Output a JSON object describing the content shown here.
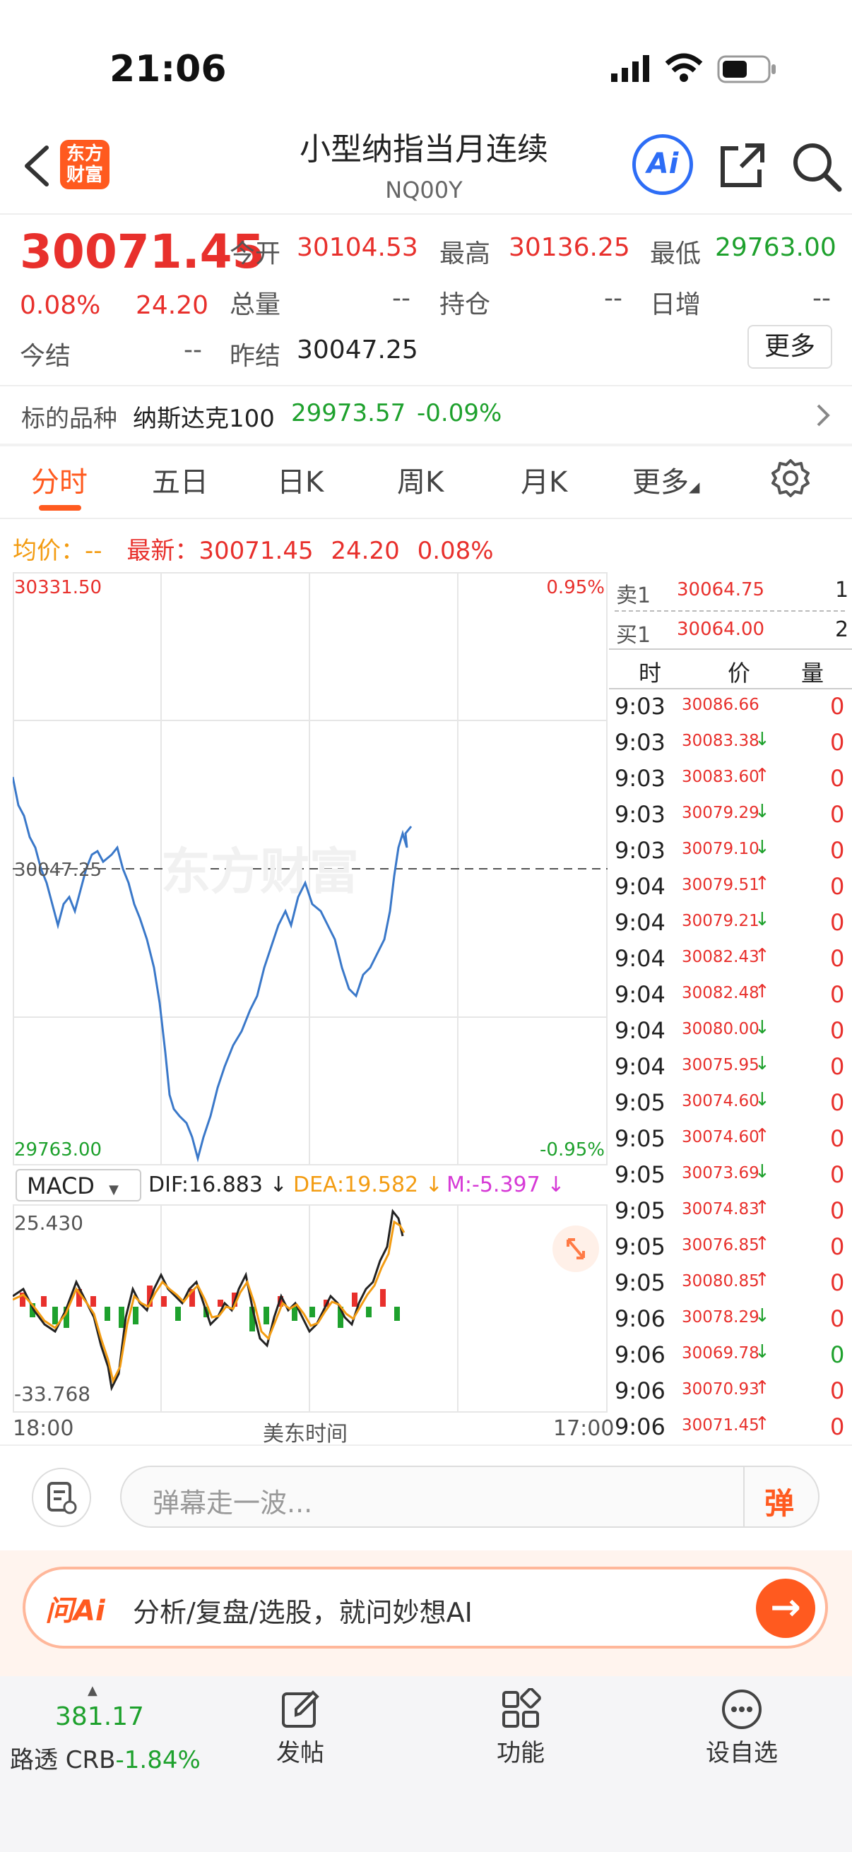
{
  "status_bar": {
    "time": "21:06"
  },
  "header": {
    "logo_text_1": "东方",
    "logo_text_2": "财富",
    "title": "小型纳指当月连续",
    "code": "NQ00Y",
    "ai_label": "Ai"
  },
  "quote": {
    "last_price": "30071.45",
    "change_pct": "0.08%",
    "change": "24.20",
    "open_label": "今开",
    "open": "30104.53",
    "high_label": "最高",
    "high": "30136.25",
    "low_label": "最低",
    "low": "29763.00",
    "volume_label": "总量",
    "volume": "--",
    "oi_label": "持仓",
    "oi": "--",
    "daily_inc_label": "日增",
    "daily_inc": "--",
    "settle_label": "今结",
    "settle": "--",
    "prev_settle_label": "昨结",
    "prev_settle": "30047.25",
    "more_label": "更多"
  },
  "underlying": {
    "label": "标的品种",
    "name": "纳斯达克100",
    "price": "29973.57",
    "change_pct": "-0.09%"
  },
  "tabs": [
    "分时",
    "五日",
    "日K",
    "周K",
    "月K",
    "更多"
  ],
  "active_tab": 0,
  "info_line": {
    "avg_label": "均价：",
    "avg_value": "--",
    "latest_label": "最新：",
    "latest_value": "30071.45",
    "change": "24.20",
    "change_pct": "0.08%"
  },
  "chart_axis": {
    "top_price": "30331.50",
    "mid_price": "30047.25",
    "bottom_price": "29763.00",
    "top_pct": "0.95%",
    "bottom_pct": "-0.95%",
    "x_start": "18:00",
    "x_mid": "美东时间",
    "x_end": "17:00",
    "watermark": "东方财富"
  },
  "macd": {
    "selector": "MACD",
    "dif": "DIF:16.883 ↓",
    "dea": "DEA:19.582 ↓",
    "m": "M:-5.397 ↓",
    "top_value": "25.430",
    "bottom_value": "-33.768"
  },
  "orderbook": {
    "ask_label": "卖1",
    "ask_price": "30064.75",
    "ask_qty": "1",
    "bid_label": "买1",
    "bid_price": "30064.00",
    "bid_qty": "2",
    "col_time": "时",
    "col_price": "价",
    "col_qty": "量"
  },
  "ticks": [
    {
      "t": "9:03",
      "p": "30086.66",
      "d": "",
      "q": "0",
      "qc": "red"
    },
    {
      "t": "9:03",
      "p": "30083.38",
      "d": "↓",
      "q": "0",
      "qc": "red"
    },
    {
      "t": "9:03",
      "p": "30083.60",
      "d": "↑",
      "q": "0",
      "qc": "red"
    },
    {
      "t": "9:03",
      "p": "30079.29",
      "d": "↓",
      "q": "0",
      "qc": "red"
    },
    {
      "t": "9:03",
      "p": "30079.10",
      "d": "↓",
      "q": "0",
      "qc": "red"
    },
    {
      "t": "9:04",
      "p": "30079.51",
      "d": "↑",
      "q": "0",
      "qc": "red"
    },
    {
      "t": "9:04",
      "p": "30079.21",
      "d": "↓",
      "q": "0",
      "qc": "red"
    },
    {
      "t": "9:04",
      "p": "30082.43",
      "d": "↑",
      "q": "0",
      "qc": "red"
    },
    {
      "t": "9:04",
      "p": "30082.48",
      "d": "↑",
      "q": "0",
      "qc": "red"
    },
    {
      "t": "9:04",
      "p": "30080.00",
      "d": "↓",
      "q": "0",
      "qc": "red"
    },
    {
      "t": "9:04",
      "p": "30075.95",
      "d": "↓",
      "q": "0",
      "qc": "red"
    },
    {
      "t": "9:05",
      "p": "30074.60",
      "d": "↓",
      "q": "0",
      "qc": "red"
    },
    {
      "t": "9:05",
      "p": "30074.60",
      "d": "↑",
      "q": "0",
      "qc": "red"
    },
    {
      "t": "9:05",
      "p": "30073.69",
      "d": "↓",
      "q": "0",
      "qc": "red"
    },
    {
      "t": "9:05",
      "p": "30074.83",
      "d": "↑",
      "q": "0",
      "qc": "red"
    },
    {
      "t": "9:05",
      "p": "30076.85",
      "d": "↑",
      "q": "0",
      "qc": "red"
    },
    {
      "t": "9:05",
      "p": "30080.85",
      "d": "↑",
      "q": "0",
      "qc": "red"
    },
    {
      "t": "9:06",
      "p": "30078.29",
      "d": "↓",
      "q": "0",
      "qc": "red"
    },
    {
      "t": "9:06",
      "p": "30069.78",
      "d": "↓",
      "q": "0",
      "qc": "green"
    },
    {
      "t": "9:06",
      "p": "30070.93",
      "d": "↑",
      "q": "0",
      "qc": "red"
    },
    {
      "t": "9:06",
      "p": "30071.45",
      "d": "↑",
      "q": "0",
      "qc": "red"
    }
  ],
  "comment": {
    "placeholder": "弹幕走一波...",
    "danmu_label": "弹"
  },
  "ai_bar": {
    "brand": "问Ai",
    "text": "分析/复盘/选股，就问妙想AI"
  },
  "bottom_nav": {
    "ticker_value": "381.17",
    "ticker_name": "路透 CRB",
    "ticker_change": "-1.84%",
    "post_label": "发帖",
    "func_label": "功能",
    "watch_label": "设自选"
  },
  "colors": {
    "up": "#e8302c",
    "down": "#1ea12d",
    "accent": "#ff5a1f",
    "line": "#3a78c9",
    "dea": "#f39c12",
    "m": "#d63ad6"
  }
}
